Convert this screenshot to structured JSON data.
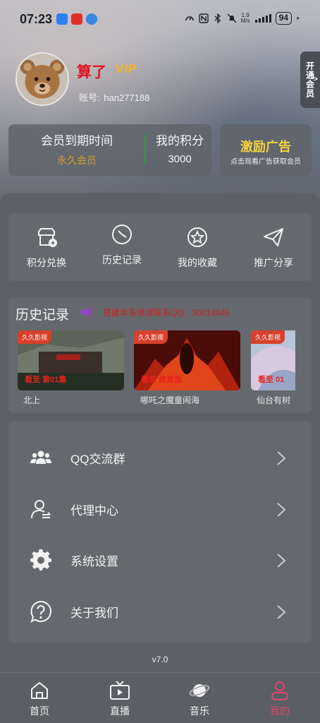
{
  "status_bar": {
    "time": "07:23",
    "speed_value": "1.9",
    "speed_unit": "M/s",
    "battery": "94"
  },
  "profile": {
    "username": "算了",
    "vip_badge": "VIP",
    "account_label": "账号:",
    "account_id": "han277188",
    "open_vip": "开通会员"
  },
  "member": {
    "expire_label": "会员到期时间",
    "expire_value": "永久会员",
    "points_label": "我的积分",
    "points_value": "3000"
  },
  "ad": {
    "title": "激励广告",
    "subtitle": "点击观看广告获取会员"
  },
  "quick_actions": [
    {
      "label": "积分兑换",
      "icon": "exchange-icon"
    },
    {
      "label": "历史记录",
      "icon": "clock-icon"
    },
    {
      "label": "我的收藏",
      "icon": "star-icon"
    },
    {
      "label": "推广分享",
      "icon": "share-icon"
    }
  ],
  "history": {
    "title": "历史记录",
    "notice": "搭建本系统请联系QQ：30014045",
    "items": [
      {
        "tag": "久久影视",
        "progress": "看至 第01集",
        "title": "北上"
      },
      {
        "tag": "久久影视",
        "progress": "看至 修复版",
        "title": "哪吒之魔童闹海"
      },
      {
        "tag": "久久影视",
        "progress": "看至 01",
        "title": "仙台有树"
      }
    ]
  },
  "menu": [
    {
      "label": "QQ交流群",
      "icon": "group-icon"
    },
    {
      "label": "代理中心",
      "icon": "agent-icon"
    },
    {
      "label": "系统设置",
      "icon": "gear-icon"
    },
    {
      "label": "关于我们",
      "icon": "question-icon"
    }
  ],
  "version": "v7.0",
  "nav": [
    {
      "label": "首页",
      "icon": "home-icon"
    },
    {
      "label": "直播",
      "icon": "tv-icon"
    },
    {
      "label": "音乐",
      "icon": "planet-icon"
    },
    {
      "label": "我的",
      "icon": "user-icon"
    }
  ],
  "colors": {
    "accent_red": "#e0141e",
    "vip_gold": "#ffb31a",
    "points_green": "#2f9a44",
    "ad_yellow": "#f4d23d",
    "nav_active": "#e2456f"
  }
}
